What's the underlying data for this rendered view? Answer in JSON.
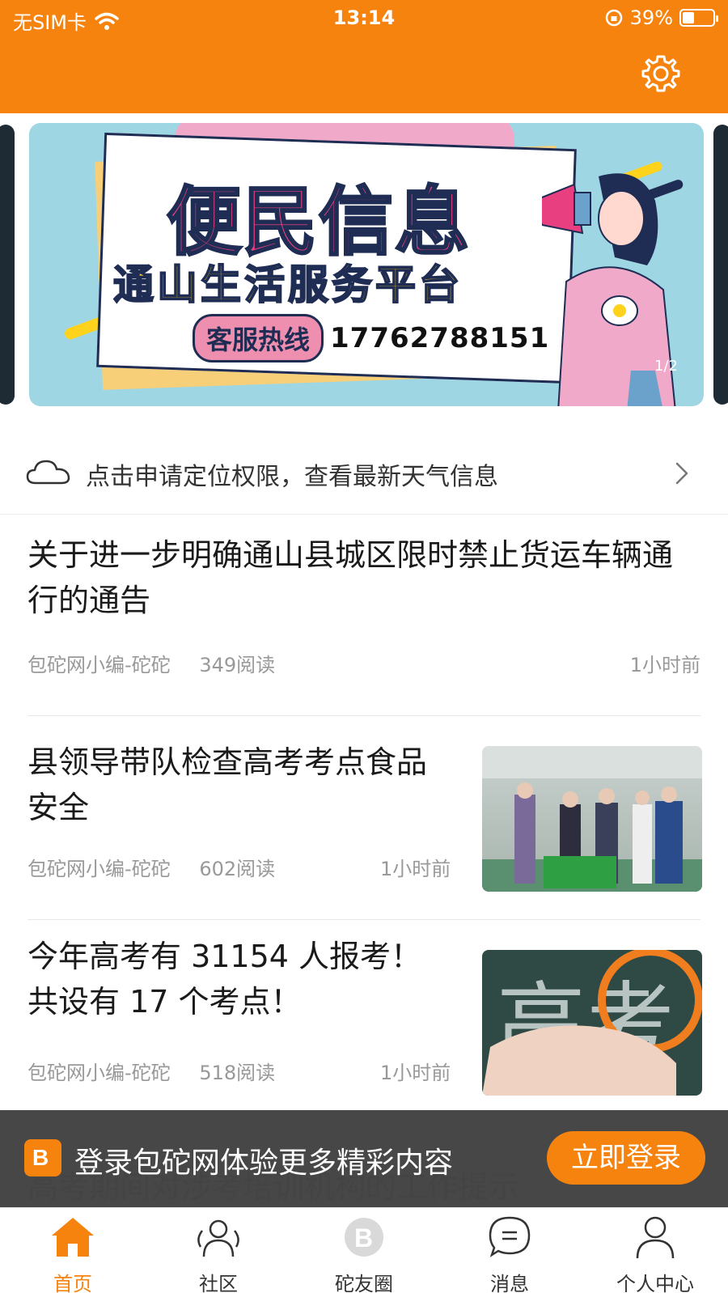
{
  "status_bar": {
    "carrier": "无SIM卡",
    "time": "13:14",
    "battery": "39%",
    "battery_level": 0.39
  },
  "header": {
    "settings_icon": "gear-icon"
  },
  "banner": {
    "title": "便民信息",
    "subtitle": "通山生活服务平台",
    "hotline_label": "客服热线",
    "hotline_number": "17762788151",
    "page_indicator": "1/2"
  },
  "weather": {
    "text": "点击申请定位权限，查看最新天气信息"
  },
  "news": [
    {
      "title": "关于进一步明确通山县城区限时禁止货运车辆通行的通告",
      "author": "包砣网小编-砣砣",
      "reads": "349阅读",
      "time": "1小时前"
    },
    {
      "title": "县领导带队检查高考考点食品安全",
      "author": "包砣网小编-砣砣",
      "reads": "602阅读",
      "time": "1小时前"
    },
    {
      "title": "今年高考有 31154 人报考！共设有 17 个考点！",
      "author": "包砣网小编-砣砣",
      "reads": "518阅读",
      "time": "1小时前"
    },
    {
      "title": "高考期间对涉考培训机构的工作提示"
    }
  ],
  "thumb2_text": "高考",
  "login_bar": {
    "message": "登录包砣网体验更多精彩内容",
    "button": "立即登录"
  },
  "tabs": [
    {
      "label": "首页",
      "icon": "home-icon"
    },
    {
      "label": "社区",
      "icon": "community-icon"
    },
    {
      "label": "砣友圈",
      "icon": "moments-icon"
    },
    {
      "label": "消息",
      "icon": "message-icon"
    },
    {
      "label": "个人中心",
      "icon": "user-icon"
    }
  ],
  "colors": {
    "accent": "#f7830f",
    "text": "#1a1a1a",
    "muted": "#999999"
  }
}
